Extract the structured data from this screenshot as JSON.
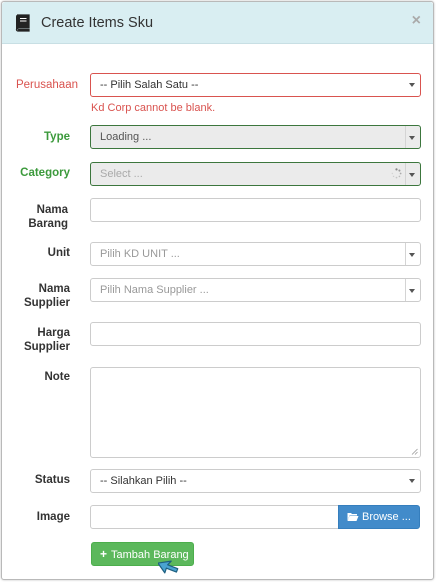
{
  "modal": {
    "title": "Create Items Sku",
    "close": "×"
  },
  "form": {
    "perusahaan": {
      "label": "Perusahaan",
      "value": "-- Pilih Salah Satu --",
      "error": "Kd Corp cannot be blank."
    },
    "type": {
      "label": "Type",
      "value": "Loading ..."
    },
    "category": {
      "label": "Category",
      "placeholder": "Select ..."
    },
    "nama_barang": {
      "label_1": "Nama",
      "label_2": "Barang",
      "value": ""
    },
    "unit": {
      "label": "Unit",
      "placeholder": "Pilih KD UNIT ..."
    },
    "nama_supplier": {
      "label_1": "Nama",
      "label_2": "Supplier",
      "placeholder": "Pilih Nama Supplier ..."
    },
    "harga_supplier": {
      "label_1": "Harga",
      "label_2": "Supplier",
      "value": ""
    },
    "note": {
      "label": "Note",
      "value": ""
    },
    "status": {
      "label": "Status",
      "value": "-- Silahkan Pilih --"
    },
    "image": {
      "label": "Image",
      "browse_label": "Browse ..."
    },
    "submit_label": "Tambah Barang"
  },
  "colors": {
    "header_bg": "#d9eef2",
    "error": "#d9534f",
    "success": "#3c9a3c",
    "primary": "#428bca",
    "submit": "#5cb85c"
  },
  "icons": [
    "book-icon",
    "close-icon",
    "chevron-down-icon",
    "spinner-icon",
    "folder-open-icon",
    "plus-icon",
    "cursor-arrow-icon"
  ]
}
